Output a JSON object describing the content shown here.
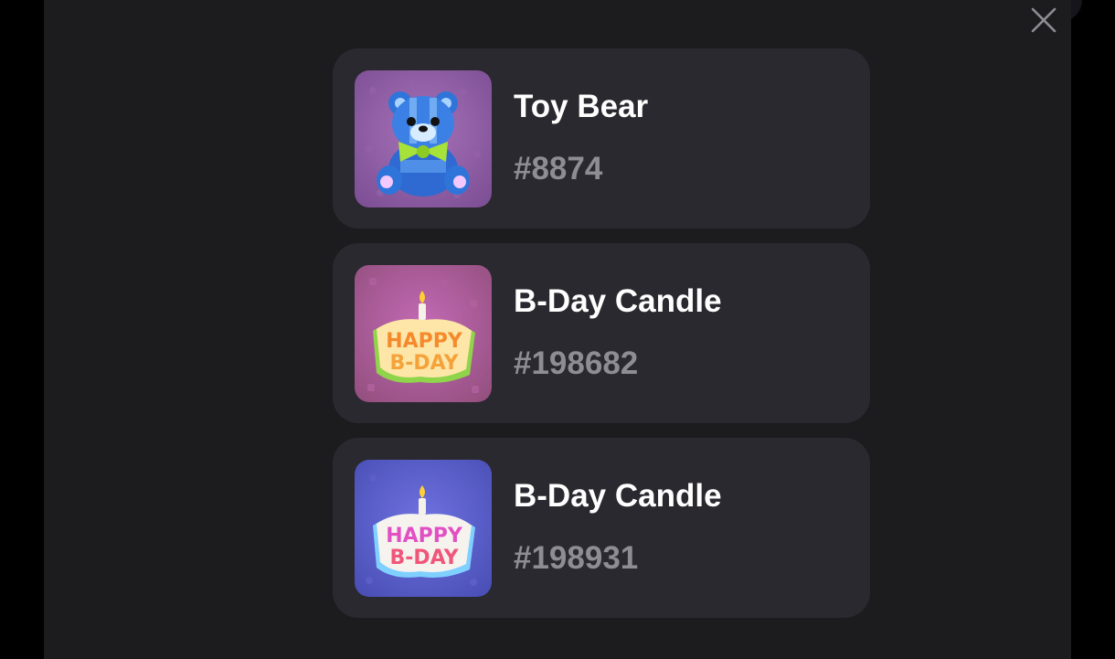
{
  "modal": {
    "close_icon": "close-icon",
    "items": [
      {
        "name": "Toy Bear",
        "number": "#8874",
        "thumbnail": "toy-bear-image",
        "background": "#8e5aa6"
      },
      {
        "name": "B-Day Candle",
        "number": "#198682",
        "thumbnail": "bday-candle-image",
        "background": "#a35a9a",
        "image_text": [
          "HAPPY",
          "B-DAY"
        ]
      },
      {
        "name": "B-Day Candle",
        "number": "#198931",
        "thumbnail": "bday-candle-image",
        "background": "#5a5cc4",
        "image_text": [
          "HAPPY",
          "B-DAY"
        ]
      }
    ]
  },
  "colors": {
    "page_bg": "#000000",
    "modal_bg": "#1c1c1e",
    "card_bg": "#2a292f",
    "title_text": "#ffffff",
    "number_text": "#8e8d93"
  }
}
